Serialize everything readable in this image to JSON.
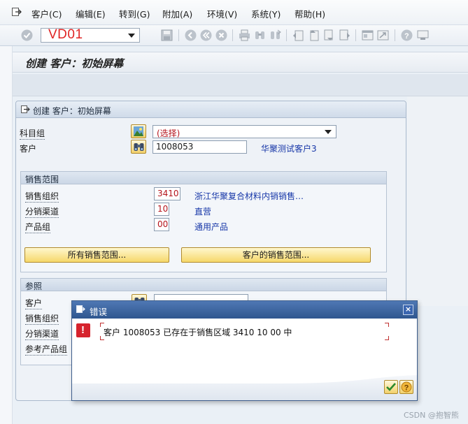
{
  "menubar": {
    "items": [
      "客户(C)",
      "编辑(E)",
      "转到(G)",
      "附加(A)",
      "环境(V)",
      "系统(Y)",
      "帮助(H)"
    ]
  },
  "toolbar": {
    "command_value": "VD01",
    "icons": [
      "enter-icon",
      "save-icon",
      "back-icon",
      "exit-icon",
      "cancel-icon",
      "print-icon",
      "find-icon",
      "find-next-icon",
      "first-page-icon",
      "prev-page-icon",
      "next-page-icon",
      "last-page-icon",
      "new-session-icon",
      "shortcut-icon",
      "help-icon",
      "customize-layout-icon"
    ]
  },
  "screen": {
    "title": "创建 客户：初始屏幕"
  },
  "main_panel": {
    "title": "创建 客户：初始屏幕",
    "account_group_label": "科目组",
    "account_group_value": "(选择)",
    "customer_label": "客户",
    "customer_value": "1008053",
    "customer_desc": "华聚测试客户3"
  },
  "sales_area": {
    "title": "销售范围",
    "sales_org_label": "销售组织",
    "sales_org_value": "3410",
    "sales_org_desc": "浙江华聚复合材料内销销售…",
    "dist_channel_label": "分销渠道",
    "dist_channel_value": "10",
    "dist_channel_desc": "直营",
    "division_label": "产品组",
    "division_value": "00",
    "division_desc": "通用产品",
    "all_sales_areas_button": "所有销售范围...",
    "customer_sales_areas_button": "客户的销售范围..."
  },
  "reference": {
    "title": "参照",
    "customer_label": "客户",
    "sales_org_label": "销售组织",
    "dist_channel_label": "分销渠道",
    "ref_division_label": "参考产品组"
  },
  "dialog": {
    "title": "错误",
    "close_label": "×",
    "message": "客户 1008053 已存在于销售区域 3410 10 00 中"
  },
  "watermark": "CSDN @抱智熊"
}
